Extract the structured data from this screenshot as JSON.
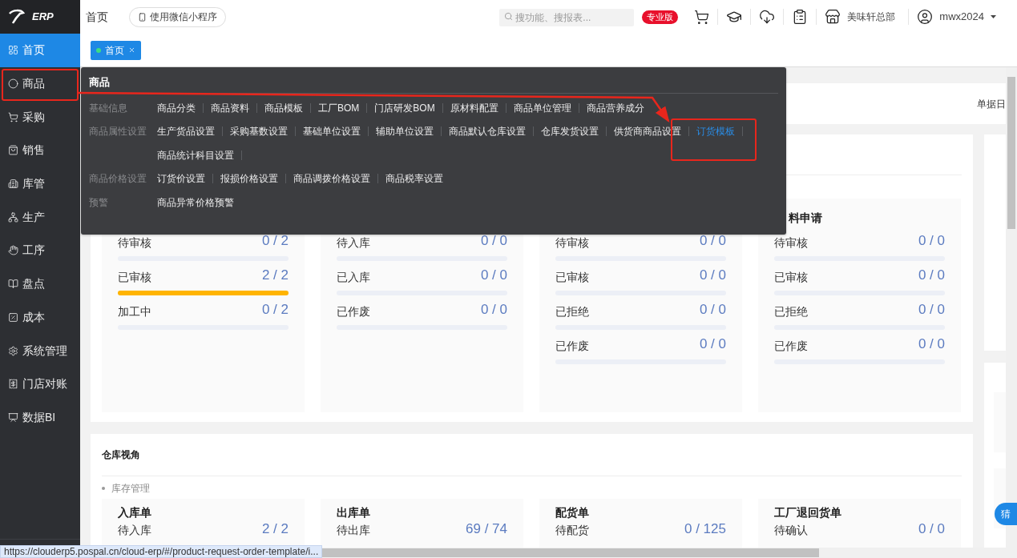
{
  "logo": {
    "text": "ERP"
  },
  "sidebar": {
    "items": [
      {
        "label": "首页",
        "selected": true
      },
      {
        "label": "商品",
        "selected": false
      },
      {
        "label": "采购",
        "selected": false
      },
      {
        "label": "销售",
        "selected": false
      },
      {
        "label": "库管",
        "selected": false
      },
      {
        "label": "生产",
        "selected": false
      },
      {
        "label": "工序",
        "selected": false
      },
      {
        "label": "盘点",
        "selected": false
      },
      {
        "label": "成本",
        "selected": false
      },
      {
        "label": "系统管理",
        "selected": false
      },
      {
        "label": "门店对账",
        "selected": false
      },
      {
        "label": "数据BI",
        "selected": false
      }
    ]
  },
  "header": {
    "breadcrumb": "首页",
    "mini_program_button": "使用微信小程序",
    "search": {
      "placeholder": "搜功能、搜报表..."
    },
    "edition_badge": "专业版",
    "store": "美味轩总部",
    "user": "mwx2024"
  },
  "tabs": [
    {
      "label": "首页",
      "selected": true
    }
  ],
  "menu_popup": {
    "title": "商品",
    "groups": [
      {
        "label": "基础信息",
        "items": [
          {
            "label": "商品分类",
            "selected": false
          },
          {
            "label": "商品资料",
            "selected": false
          },
          {
            "label": "商品模板",
            "selected": false
          },
          {
            "label": "工厂BOM",
            "selected": false
          },
          {
            "label": "门店研发BOM",
            "selected": false
          },
          {
            "label": "原材料配置",
            "selected": false
          },
          {
            "label": "商品单位管理",
            "selected": false
          },
          {
            "label": "商品营养成分",
            "selected": false
          }
        ]
      },
      {
        "label": "商品属性设置",
        "items": [
          {
            "label": "生产货品设置",
            "selected": false
          },
          {
            "label": "采购基数设置",
            "selected": false
          },
          {
            "label": "基础单位设置",
            "selected": false
          },
          {
            "label": "辅助单位设置",
            "selected": false
          },
          {
            "label": "商品默认仓库设置",
            "selected": false
          },
          {
            "label": "仓库发货设置",
            "selected": false
          },
          {
            "label": "供货商商品设置",
            "selected": false
          },
          {
            "label": "订货模板",
            "selected": true
          },
          {
            "label": "商品统计科目设置",
            "selected": false
          }
        ]
      },
      {
        "label": "商品价格设置",
        "items": [
          {
            "label": "订货价设置",
            "selected": false
          },
          {
            "label": "报损价格设置",
            "selected": false
          },
          {
            "label": "商品调拨价格设置",
            "selected": false
          },
          {
            "label": "商品税率设置",
            "selected": false
          }
        ]
      },
      {
        "label": "预警",
        "items": [
          {
            "label": "商品异常价格预警",
            "selected": false
          }
        ]
      }
    ]
  },
  "top_band": {
    "text": "单据日"
  },
  "workflow_cards": [
    {
      "rows": [
        {
          "label": "待审核",
          "value": "0 / 2",
          "level": 0
        },
        {
          "label": "已审核",
          "value": "2 / 2",
          "level": 1
        },
        {
          "label": "加工中",
          "value": "0 / 2",
          "level": 0
        }
      ]
    },
    {
      "rows": [
        {
          "label": "待入库",
          "value": "0 / 0",
          "level": 0
        },
        {
          "label": "已入库",
          "value": "0 / 0",
          "level": 0
        },
        {
          "label": "已作废",
          "value": "0 / 0",
          "level": 0
        }
      ]
    },
    {
      "rows": [
        {
          "label": "待审核",
          "value": "0 / 0",
          "level": 0
        },
        {
          "label": "已审核",
          "value": "0 / 0",
          "level": 0
        },
        {
          "label": "已拒绝",
          "value": "0 / 0",
          "level": 0
        },
        {
          "label": "已作废",
          "value": "0 / 0",
          "level": 0
        }
      ]
    },
    {
      "title": "料申请",
      "rows": [
        {
          "label": "待审核",
          "value": "0 / 0",
          "level": 0
        },
        {
          "label": "已审核",
          "value": "0 / 0",
          "level": 0
        },
        {
          "label": "已拒绝",
          "value": "0 / 0",
          "level": 0
        },
        {
          "label": "已作废",
          "value": "0 / 0",
          "level": 0
        }
      ]
    }
  ],
  "warehouse": {
    "title": "仓库视角",
    "section": "库存管理",
    "cards": [
      {
        "title": "入库单",
        "rows": [
          {
            "label": "待入库",
            "value": "2 / 2"
          }
        ]
      },
      {
        "title": "出库单",
        "rows": [
          {
            "label": "待出库",
            "value": "69 / 74"
          }
        ]
      },
      {
        "title": "配货单",
        "rows": [
          {
            "label": "待配货",
            "value": "0 / 125"
          }
        ]
      },
      {
        "title": "工厂退回货单",
        "rows": [
          {
            "label": "待确认",
            "value": "0 / 0"
          }
        ]
      }
    ]
  },
  "assistant_button": "猜",
  "status_url": "https://clouderp5.pospal.cn/cloud-erp/#/product-request-order-template/i..."
}
